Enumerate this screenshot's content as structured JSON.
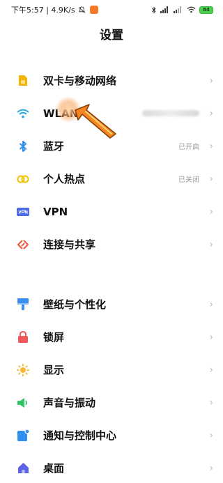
{
  "status": {
    "time_speed": "下午5:57 | 4.9K/s",
    "battery": "84"
  },
  "header": {
    "title": "设置"
  },
  "group1": [
    {
      "name": "dual-sim",
      "label": "双卡与移动网络",
      "value": ""
    },
    {
      "name": "wlan",
      "label": "WLAN",
      "value": ""
    },
    {
      "name": "bluetooth",
      "label": "蓝牙",
      "value": "已开启"
    },
    {
      "name": "hotspot",
      "label": "个人热点",
      "value": "已关闭"
    },
    {
      "name": "vpn",
      "label": "VPN",
      "value": ""
    },
    {
      "name": "connection-sharing",
      "label": "连接与共享",
      "value": ""
    }
  ],
  "group2": [
    {
      "name": "wallpaper",
      "label": "壁纸与个性化"
    },
    {
      "name": "lock-screen",
      "label": "锁屏"
    },
    {
      "name": "display",
      "label": "显示"
    },
    {
      "name": "sound",
      "label": "声音与振动"
    },
    {
      "name": "notifications",
      "label": "通知与控制中心"
    },
    {
      "name": "desktop",
      "label": "桌面"
    }
  ],
  "icons": {
    "dual-sim": "sim-card-icon",
    "wlan": "wifi-icon",
    "bluetooth": "bluetooth-icon",
    "hotspot": "hotspot-icon",
    "vpn": "vpn-icon",
    "connection-sharing": "share-icon",
    "wallpaper": "paint-brush-icon",
    "lock-screen": "lock-icon",
    "display": "sun-icon",
    "sound": "speaker-icon",
    "notifications": "notification-icon",
    "desktop": "home-icon"
  },
  "colors": {
    "sim": "#f5b400",
    "wifi": "#27a9e6",
    "bluetooth": "#2f8ef0",
    "hotspot": "#f2c100",
    "vpn": "#4d6ae8",
    "share": "#ee5a40",
    "wallpaper": "#3a8ef2",
    "lock": "#f0595b",
    "sun": "#f7b733",
    "sound": "#35c46a",
    "notify": "#2f8ef0",
    "home": "#5a63e6",
    "pointer": "#f5861f"
  }
}
